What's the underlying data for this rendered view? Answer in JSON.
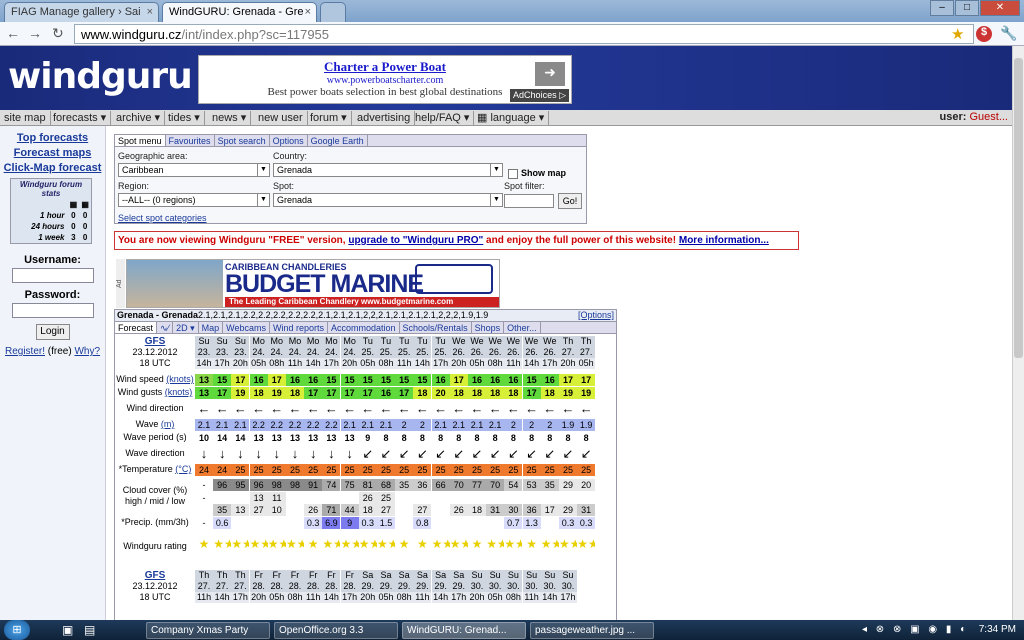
{
  "browser": {
    "tabs": [
      {
        "title": "FIAG Manage gallery › Sai",
        "close": "×"
      },
      {
        "title": "WindGURU: Grenada - Gre",
        "close": "×"
      }
    ],
    "url_host": "www.windguru.cz",
    "url_path": "/int/index.php?sc=117955"
  },
  "banner": {
    "logo": "windguru",
    "ad_title": "Charter a Power Boat",
    "ad_url": "www.powerboatscharter.com",
    "ad_desc": "Best power boats selection in best global destinations",
    "ad_choices": "AdChoices ▷"
  },
  "menu": {
    "items": [
      "site map",
      "forecasts ▾",
      "archive ▾",
      "tides ▾",
      "news ▾",
      "new user",
      "forum ▾",
      "advertising",
      "help/FAQ ▾",
      "language ▾"
    ],
    "user_label": "user:",
    "user_value": "Guest..."
  },
  "left": {
    "links": [
      "Top forecasts",
      "Forecast maps",
      "Click-Map forecast"
    ],
    "stats_title": "Windguru forum stats",
    "stats_rows": [
      {
        "label": "1 hour",
        "a": "0",
        "b": "0"
      },
      {
        "label": "24 hours",
        "a": "0",
        "b": "0"
      },
      {
        "label": "1 week",
        "a": "3",
        "b": "0"
      }
    ],
    "username": "Username:",
    "password": "Password:",
    "login": "Login",
    "register": "Register!",
    "free": " (free) ",
    "why": "Why?"
  },
  "spot": {
    "tabs": [
      "Spot menu",
      "Favourites",
      "Spot search",
      "Options",
      "Google Earth"
    ],
    "geo_label": "Geographic area:",
    "geo_value": "Caribbean",
    "country_label": "Country:",
    "country_value": "Grenada",
    "region_label": "Region:",
    "region_value": "--ALL-- (0 regions)",
    "spot_label": "Spot:",
    "spot_value": "Grenada",
    "show_map": "Show map",
    "filter_label": "Spot filter:",
    "go": "Go!",
    "select_cat": "Select spot categories"
  },
  "notice": {
    "pre": "You are now viewing Windguru \"FREE\" version, ",
    "link": "upgrade to \"Windguru PRO\"",
    "mid": " and enjoy the full power of this website! ",
    "more": "More information..."
  },
  "ad2": {
    "mark": "Ad",
    "line1": "CARIBBEAN CHANDLERIES",
    "line2": "BUDGET MARINE",
    "line3": "The Leading Caribbean Chandlery    www.budgetmarine.com"
  },
  "forecast": {
    "title": "Grenada - Grenada",
    "wave": [
      "2.1",
      "2.1",
      "2.1",
      "2.2",
      "2.2",
      "2.2",
      "2.2",
      "2.2",
      "2.1",
      "2.1",
      "2.1",
      "2",
      "2",
      "2.1",
      "2.1",
      "2.1",
      "2.1",
      "2",
      "2",
      "2",
      "1.9",
      "1.9"
    ],
    "options": "[Options]",
    "tabs": [
      "Forecast",
      "∿∕",
      "2D ▾",
      "Map",
      "Webcams",
      "Wind reports",
      "Accommodation",
      "Schools/Rentals",
      "Shops",
      "Other..."
    ],
    "model": "GFS",
    "date": "23.12.2012",
    "utc": "18 UTC",
    "days": [
      "Su",
      "Su",
      "Su",
      "Mo",
      "Mo",
      "Mo",
      "Mo",
      "Mo",
      "Mo",
      "Tu",
      "Tu",
      "Tu",
      "Tu",
      "Tu",
      "We",
      "We",
      "We",
      "We",
      "We",
      "We",
      "Th",
      "Th"
    ],
    "dates": [
      "23.",
      "23.",
      "23.",
      "24.",
      "24.",
      "24.",
      "24.",
      "24.",
      "24.",
      "25.",
      "25.",
      "25.",
      "25.",
      "25.",
      "26.",
      "26.",
      "26.",
      "26.",
      "26.",
      "26.",
      "27.",
      "27."
    ],
    "hours": [
      "14h",
      "17h",
      "20h",
      "05h",
      "08h",
      "11h",
      "14h",
      "17h",
      "20h",
      "05h",
      "08h",
      "11h",
      "14h",
      "17h",
      "20h",
      "05h",
      "08h",
      "11h",
      "14h",
      "17h",
      "20h",
      "05h"
    ],
    "labels": {
      "speed": "Wind speed",
      "gusts": "Wind gusts",
      "knots": "(knots)",
      "dir": "Wind direction",
      "wave": "Wave",
      "m": "(m)",
      "period": "Wave period (s)",
      "wdir": "Wave direction",
      "temp": "*Temperature",
      "c": "(°C)",
      "cloud": "Cloud cover (%)",
      "cloud2": "high / mid / low",
      "precip": "*Precip. (mm/3h)",
      "rating": "Windguru rating"
    },
    "speed": [
      "13",
      "15",
      "17",
      "16",
      "17",
      "16",
      "16",
      "15",
      "15",
      "15",
      "15",
      "15",
      "15",
      "16",
      "17",
      "16",
      "16",
      "16",
      "15",
      "16",
      "17",
      "17"
    ],
    "gusts": [
      "13",
      "17",
      "19",
      "18",
      "19",
      "18",
      "17",
      "17",
      "17",
      "17",
      "16",
      "17",
      "18",
      "20",
      "18",
      "18",
      "18",
      "18",
      "17",
      "18",
      "19",
      "19"
    ],
    "period": [
      "10",
      "14",
      "14",
      "13",
      "13",
      "13",
      "13",
      "13",
      "13",
      "9",
      "8",
      "8",
      "8",
      "8",
      "8",
      "8",
      "8",
      "8",
      "8",
      "8",
      "8",
      "8"
    ],
    "temp": [
      "24",
      "24",
      "25",
      "25",
      "25",
      "25",
      "25",
      "25",
      "25",
      "25",
      "25",
      "25",
      "25",
      "25",
      "25",
      "25",
      "25",
      "25",
      "25",
      "25",
      "25",
      "25"
    ],
    "cloud_high": [
      "-",
      "96",
      "95",
      "96",
      "98",
      "98",
      "91",
      "74",
      "75",
      "81",
      "68",
      "35",
      "36",
      "66",
      "70",
      "77",
      "70",
      "54",
      "53",
      "35",
      "29",
      "20"
    ],
    "cloud_mid": [
      "-",
      "",
      "",
      "13",
      "11",
      "",
      "",
      "",
      "",
      "26",
      "25",
      "",
      "",
      "",
      "",
      "",
      "",
      "",
      "",
      "",
      "",
      ""
    ],
    "cloud_low": [
      "",
      "35",
      "13",
      "27",
      "10",
      "",
      "26",
      "71",
      "44",
      "18",
      "27",
      "",
      "27",
      "",
      "26",
      "18",
      "31",
      "30",
      "36",
      "17",
      "29",
      "31"
    ],
    "precip": [
      "-",
      "0.6",
      "",
      "",
      "",
      "",
      "0.3",
      "6.9",
      "9",
      "0.3",
      "1.5",
      "",
      "0.8",
      "",
      "",
      "",
      "",
      "0.7",
      "1.3",
      "",
      "0.3",
      "0.3"
    ],
    "model2": "GFS",
    "date2": "23.12.2012",
    "utc2": "18 UTC",
    "days2": [
      "Th",
      "Th",
      "Th",
      "Fr",
      "Fr",
      "Fr",
      "Fr",
      "Fr",
      "Fr",
      "Sa",
      "Sa",
      "Sa",
      "Sa",
      "Sa",
      "Sa",
      "Su",
      "Su",
      "Su",
      "Su",
      "Su",
      "Su"
    ],
    "dates2": [
      "27.",
      "27.",
      "27.",
      "28.",
      "28.",
      "28.",
      "28.",
      "28.",
      "28.",
      "29.",
      "29.",
      "29.",
      "29.",
      "29.",
      "29.",
      "30.",
      "30.",
      "30.",
      "30.",
      "30.",
      "30."
    ],
    "hours2": [
      "11h",
      "14h",
      "17h",
      "20h",
      "05h",
      "08h",
      "11h",
      "14h",
      "17h",
      "20h",
      "05h",
      "08h",
      "11h",
      "14h",
      "17h",
      "20h",
      "05h",
      "08h",
      "11h",
      "14h",
      "17h"
    ]
  },
  "colors": {
    "speed_green": "#5fd93c",
    "speed_yellow": "#d8ef38",
    "temp_orange": "#ef7a2e",
    "cloud_dark": "#8a8a8a",
    "precip_blue": "#7c7cf0"
  },
  "taskbar": {
    "items": [
      "Company Xmas Party",
      "OpenOffice.org 3.3",
      "WindGURU: Grenad...",
      "passageweather.jpg ..."
    ],
    "clock": "7:34 PM"
  }
}
